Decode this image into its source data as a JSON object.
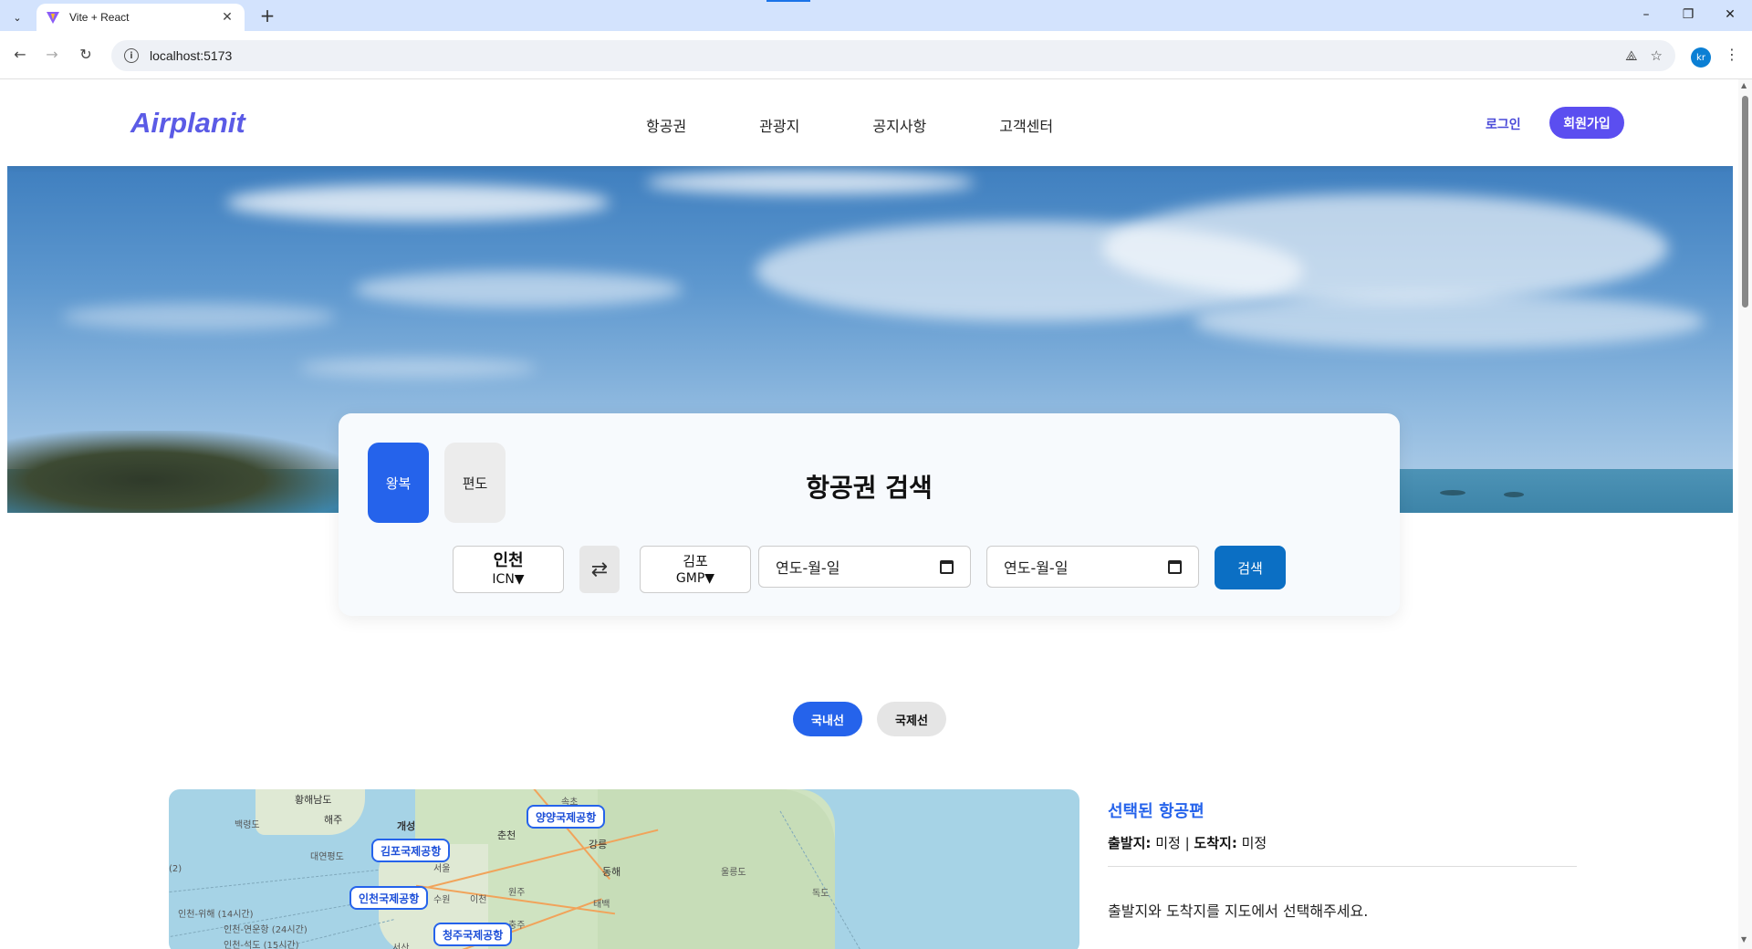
{
  "browser": {
    "tab_title": "Vite + React",
    "new_tab": "+",
    "url": "localhost:5173",
    "profile_initials": "kr",
    "window_controls": [
      "–",
      "❐",
      "✕"
    ]
  },
  "site": {
    "logo": "Airplanit",
    "nav": [
      "항공권",
      "관광지",
      "공지사항",
      "고객센터"
    ],
    "login": "로그인",
    "signup": "회원가입"
  },
  "search": {
    "title": "항공권 검색",
    "trip_types": [
      "왕복",
      "편도"
    ],
    "selected_trip": "왕복",
    "from": {
      "name": "인천",
      "code": "ICN▼"
    },
    "to": {
      "name": "김포",
      "code": "GMP▼"
    },
    "swap_icon": "⇄",
    "date_placeholder_1": "연도-월-일",
    "date_placeholder_2": "연도-월-일",
    "search_button": "검색"
  },
  "route_toggle": {
    "domestic": "국내선",
    "international": "국제선",
    "selected": "국내선"
  },
  "map": {
    "airports": [
      "양양국제공항",
      "김포국제공항",
      "인천국제공항",
      "청주국제공항"
    ],
    "labels": [
      "황해남도",
      "해주",
      "개성",
      "백령도",
      "대연평도",
      "속초",
      "춘천",
      "강릉",
      "동해",
      "울릉도",
      "독도",
      "수원",
      "이천",
      "원주",
      "태백",
      "서울",
      "충주",
      "서산"
    ],
    "route_labels": [
      "인천-위해 (14시간)",
      "인천-연운항 (24시간)",
      "인천-석도 (15시간)"
    ],
    "route_edge_label": "(2)"
  },
  "info": {
    "title": "선택된 항공편",
    "from_label": "출발지:",
    "from_value": "미정",
    "separator": "|",
    "to_label": "도착지:",
    "to_value": "미정",
    "hint": "출발지와 도착지를 지도에서 선택해주세요."
  },
  "colors": {
    "accent": "#2563eb",
    "brand": "#5b5be6",
    "signup": "#5b4ef0",
    "search_button": "#0b6fc4"
  }
}
